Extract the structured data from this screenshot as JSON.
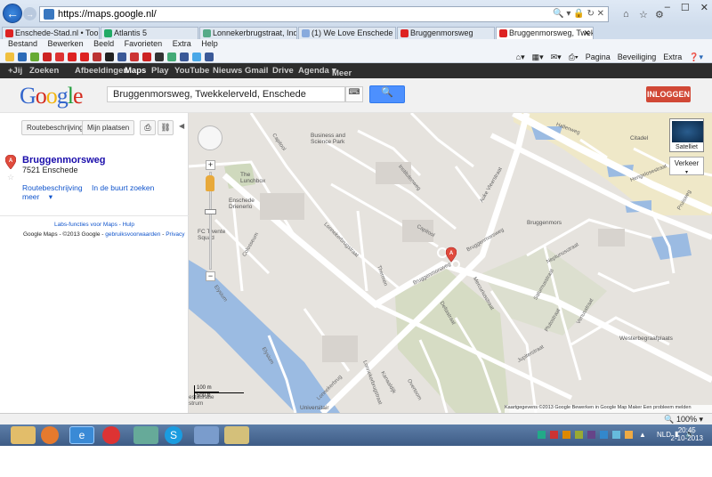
{
  "browser": {
    "url": "https://maps.google.nl/",
    "tabs": [
      {
        "label": "Enschede-Stad.nl • Toon onde...",
        "fav": "#d22"
      },
      {
        "label": "Atlantis 5",
        "fav": "#2a6"
      },
      {
        "label": "Lonnekerbrugstraat, Industrie, ...",
        "fav": "#5a8"
      },
      {
        "label": "(1) We Love Enschede",
        "fav": "#8ad"
      },
      {
        "label": "Bruggenmorsweg",
        "fav": "#d22"
      },
      {
        "label": "Bruggenmorsweg, Twekkel...",
        "fav": "#d22",
        "active": true
      }
    ],
    "menu": [
      "Bestand",
      "Bewerken",
      "Beeld",
      "Favorieten",
      "Extra",
      "Help"
    ],
    "commands": [
      "Pagina",
      "Beveiliging",
      "Extra"
    ]
  },
  "google_bar": {
    "items": [
      "+Jij",
      "Zoeken",
      "Afbeeldingen",
      "Maps",
      "Play",
      "YouTube",
      "Nieuws",
      "Gmail",
      "Drive",
      "Agenda",
      "Meer"
    ],
    "active": "Maps"
  },
  "header": {
    "logo_letters": [
      "G",
      "o",
      "o",
      "g",
      "l",
      "e"
    ],
    "logo_colors": [
      "#3366cc",
      "#d42b1e",
      "#f2b50f",
      "#3366cc",
      "#1e9e3a",
      "#d42b1e"
    ],
    "search_value": "Bruggenmorsweg, Twekkelerveld, Enschede",
    "login_label": "INLOGGEN"
  },
  "left_panel": {
    "route_label": "Routebeschrijving",
    "myplaces_label": "Mijn plaatsen",
    "pin_letter": "A",
    "result_title": "Bruggenmorsweg",
    "result_address": "7521 Enschede",
    "link_route": "Routebeschrijving",
    "link_nearby": "In de buurt zoeken",
    "link_more": "meer",
    "labs": "Labs-functies voor Maps - Hulp",
    "footer_prefix": "Google Maps  - ©2013 Google -",
    "footer_terms": "gebruiksvoorwaarden",
    "footer_privacy": "Privacy"
  },
  "map": {
    "labels": {
      "business_park": "Business and\nScience Park",
      "lunchbox": "The\nLunchbox",
      "drienerlo": "Enschede\nDrienerlo",
      "fc_twente": "FC Twente\nSquad",
      "citadel": "Citadel",
      "bruggenmors": "Bruggenmors",
      "westerbegraaf": "Westerbegraafplaats",
      "universitair": "Universitair",
      "restauratie": "estauratie\nstrum"
    },
    "streets": {
      "hengelosestraat": "Hengelosestraat",
      "auke_vleerstraat": "Auke Vleerstraat",
      "lonnekerbrugstraat": "Lonnekerbrugstraat",
      "capitool": "Capitool",
      "institutenweg": "Institutenweg",
      "bruggenmorsweg": "Bruggenmorsweg",
      "haaksbergen": "Haaksbergen",
      "javastraat": "Javastraat",
      "jupiterstraat": "Jupiterstraat",
      "deltastraat": "Deltastraat",
      "mercuriusstraat": "Mercuriusstraat",
      "saturnusstraat": "Saturnusstraat",
      "neptunusstraat": "Neptunusstraat",
      "plutostraat": "Plutostraat",
      "venusstraat": "Venusstraat",
      "thermen": "Thermen",
      "elysium": "Elysium",
      "lonnekerbrug": "Lonnekerbrug",
      "kanaaldijk": "Kanaaldijk",
      "overtoom": "Overtoom",
      "colosseum": "Colosseum",
      "hallenweg": "Hallenweg",
      "pruisweg": "Pruisweg",
      "lonnekerbrugstr2": "Lonnekerbrugstraat",
      "capitool2": "Capitool",
      "planetenstraat": "Planetenstraat"
    },
    "satellite_label": "Satelliet",
    "traffic_label": "Verkeer",
    "scale_m": "100 m",
    "scale_ft": "500 ft",
    "attribution": "Kaartgegevens ©2013 Google   Bewerken in Google Map Maker   Een probleem melden",
    "marker_letter": "A"
  },
  "status": {
    "zoom": "100%"
  },
  "taskbar": {
    "time": "20:45",
    "date": "2-10-2013",
    "lang": "NLD"
  }
}
